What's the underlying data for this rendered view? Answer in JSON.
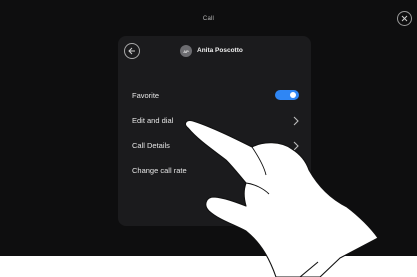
{
  "header": {
    "title": "Call"
  },
  "contact": {
    "initials": "AP",
    "name": "Anita Poscotto"
  },
  "menu": {
    "favorite_label": "Favorite",
    "favorite_on": true,
    "edit_dial_label": "Edit and dial",
    "call_details_label": "Call Details",
    "change_rate_label": "Change call rate"
  },
  "colors": {
    "background": "#0e0e0f",
    "card": "#1b1b1d",
    "toggle_accent": "#2f86f4"
  },
  "icons": {
    "close": "close-icon",
    "back": "arrow-left-icon",
    "chevron": "chevron-right-icon",
    "hand": "pointing-hand-illustration"
  }
}
